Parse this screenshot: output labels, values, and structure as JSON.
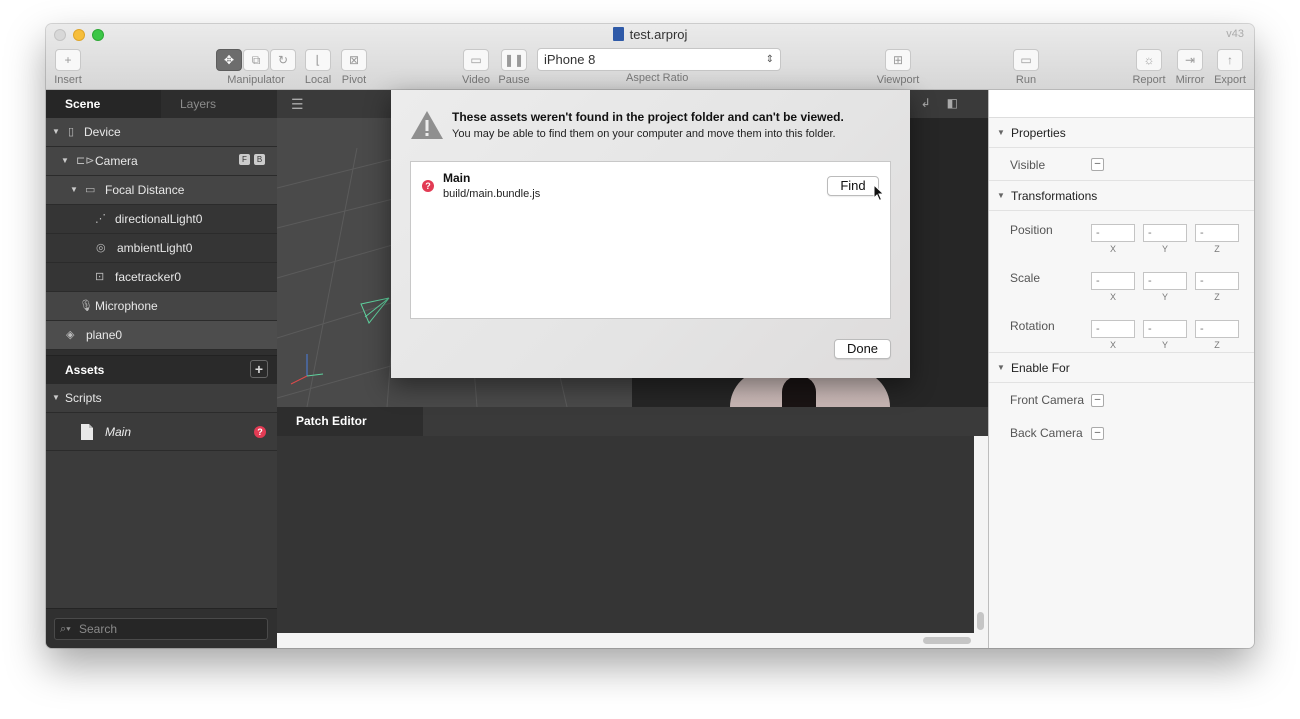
{
  "window": {
    "title": "test.arproj",
    "version": "v43"
  },
  "toolbar": {
    "insert_label": "Insert",
    "manipulator_label": "Manipulator",
    "local_label": "Local",
    "pivot_label": "Pivot",
    "video_label": "Video",
    "pause_label": "Pause",
    "device_select_value": "iPhone 8",
    "aspect_ratio_label": "Aspect Ratio",
    "viewport_label": "Viewport",
    "run_label": "Run",
    "report_label": "Report",
    "mirror_label": "Mirror",
    "export_label": "Export"
  },
  "left_panel": {
    "tabs": [
      "Scene",
      "Layers"
    ],
    "active_tab": "Scene",
    "scene_tree": [
      {
        "label": "Device",
        "icon": "phone-icon"
      },
      {
        "label": "Camera",
        "icon": "camera-icon",
        "badges": [
          "F",
          "B"
        ]
      },
      {
        "label": "Focal Distance",
        "icon": "focal-distance-icon"
      },
      {
        "label": "directionalLight0",
        "icon": "directional-light-icon"
      },
      {
        "label": "ambientLight0",
        "icon": "ambient-light-icon"
      },
      {
        "label": "facetracker0",
        "icon": "facetracker-icon"
      },
      {
        "label": "Microphone",
        "icon": "microphone-icon"
      },
      {
        "label": "plane0",
        "icon": "plane-icon"
      }
    ],
    "assets_title": "Assets",
    "scripts_label": "Scripts",
    "scripts": [
      {
        "label": "Main",
        "status": "missing"
      }
    ],
    "search_placeholder": "Search"
  },
  "patch_editor": {
    "tab_label": "Patch Editor"
  },
  "right_panel": {
    "properties_label": "Properties",
    "visible_label": "Visible",
    "transformations_label": "Transformations",
    "position_label": "Position",
    "scale_label": "Scale",
    "rotation_label": "Rotation",
    "field_placeholder": "-",
    "axis_labels": [
      "X",
      "Y",
      "Z"
    ],
    "enable_for_label": "Enable For",
    "front_camera_label": "Front Camera",
    "back_camera_label": "Back Camera"
  },
  "modal": {
    "title": "These assets weren't found in the project folder and can't be viewed.",
    "subtitle": "You may be able to find them on your computer and move them into this folder.",
    "assets": [
      {
        "name": "Main",
        "path": "build/main.bundle.js"
      }
    ],
    "find_label": "Find",
    "done_label": "Done"
  },
  "colors": {
    "error_badge": "#e23b54",
    "traffic_close": "#d8d8d8",
    "traffic_minimize": "#f6be3b",
    "traffic_maximize": "#3cc647",
    "panel_dark": "#3b3b3b"
  }
}
